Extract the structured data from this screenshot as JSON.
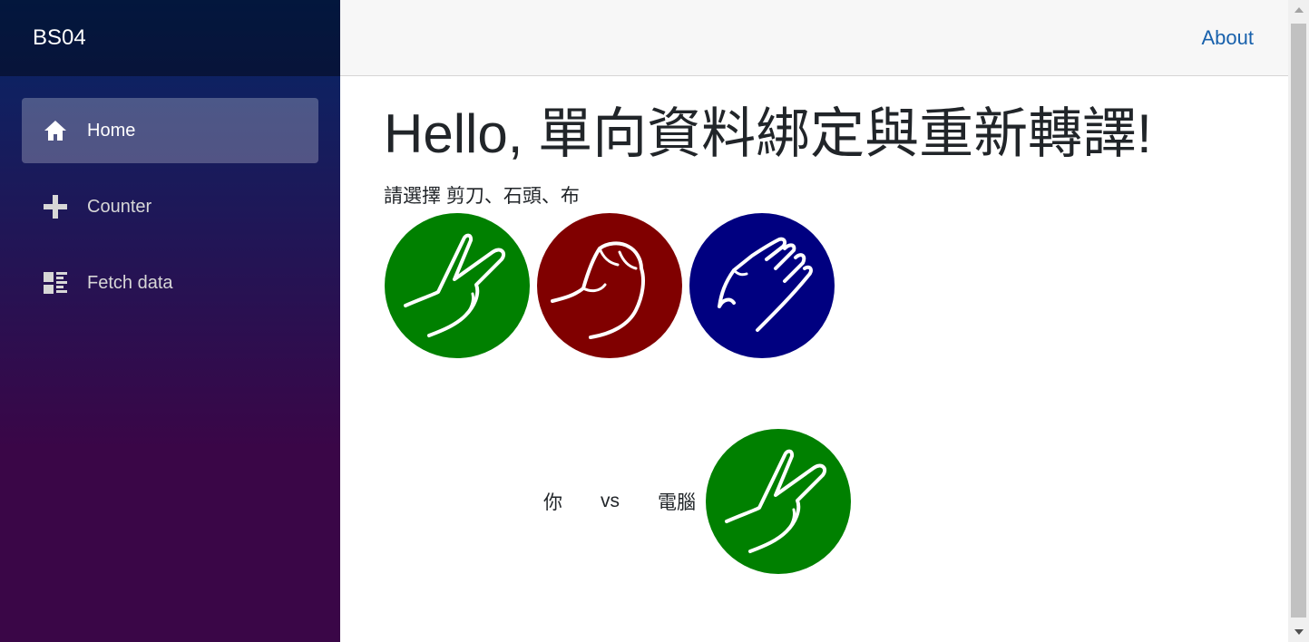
{
  "sidebar": {
    "brand": "BS04",
    "items": [
      {
        "label": "Home",
        "icon": "home-icon",
        "active": true
      },
      {
        "label": "Counter",
        "icon": "plus-icon",
        "active": false
      },
      {
        "label": "Fetch data",
        "icon": "list-icon",
        "active": false
      }
    ]
  },
  "top_row": {
    "about": "About"
  },
  "main": {
    "title": "Hello, 單向資料綁定與重新轉譯!",
    "prompt": "請選擇 剪刀、石頭、布",
    "choices": [
      {
        "name": "scissors",
        "color": "#008000"
      },
      {
        "name": "rock",
        "color": "#800000"
      },
      {
        "name": "paper",
        "color": "#000080"
      }
    ],
    "result": {
      "you_label": "你",
      "vs_label": "vs",
      "computer_label": "電腦",
      "computer_choice": "scissors"
    }
  },
  "colors": {
    "sidebar_top": "#052767",
    "sidebar_bottom": "#3a0647",
    "link": "#1861ac"
  }
}
